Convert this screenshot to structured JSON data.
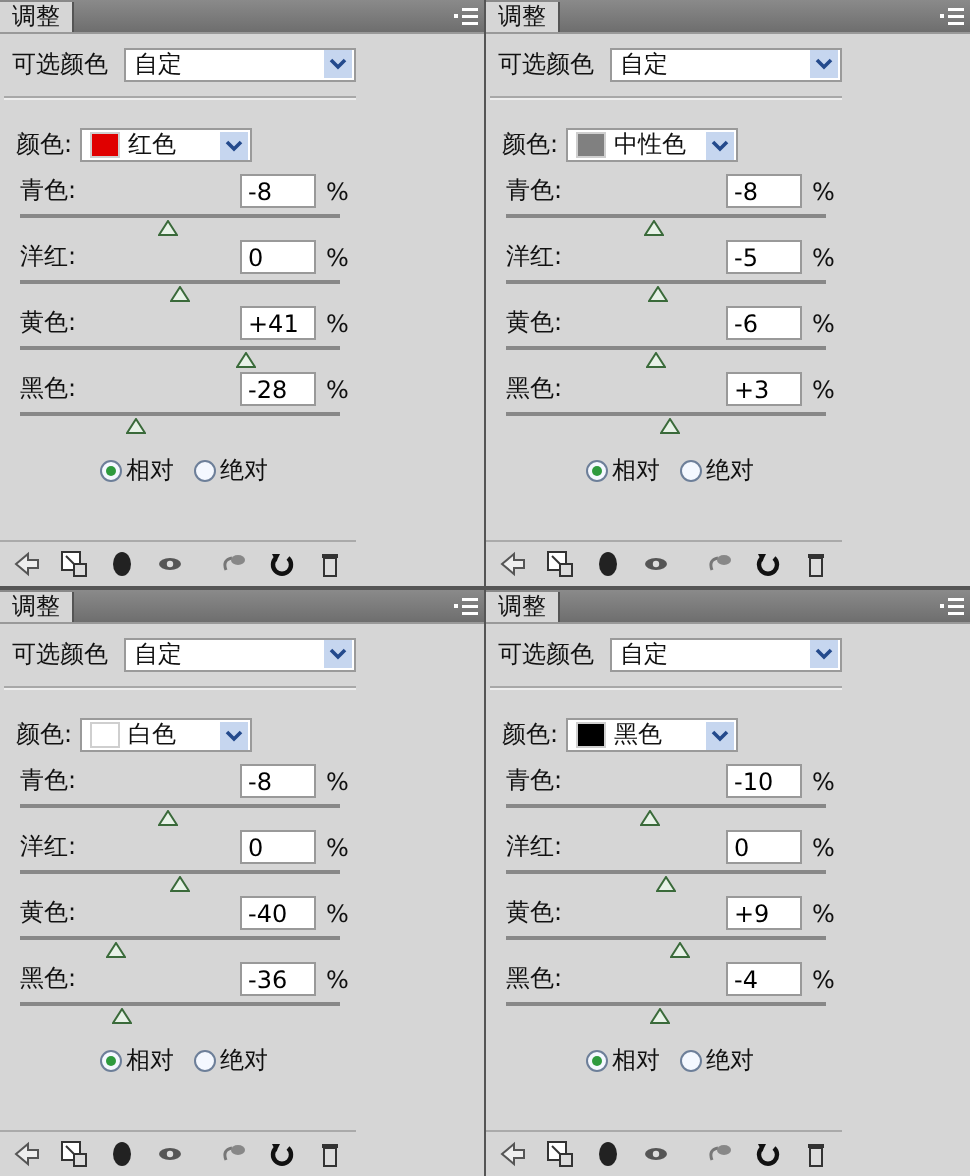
{
  "panels": [
    {
      "tab": "调整",
      "adjustment": "可选颜色",
      "preset": "自定",
      "color_label": "颜色:",
      "color_choice": {
        "name": "红色",
        "color": "#e00000"
      },
      "sliders": [
        {
          "label": "青色:",
          "value": "-8",
          "unit": "%",
          "level": 0.46
        },
        {
          "label": "洋红:",
          "value": "0",
          "unit": "%",
          "level": 0.5
        },
        {
          "label": "黄色:",
          "value": "+41",
          "unit": "%",
          "level": 0.705
        },
        {
          "label": "黑色:",
          "value": "-28",
          "unit": "%",
          "level": 0.36
        }
      ],
      "methods": [
        {
          "label": "相对",
          "selected": true
        },
        {
          "label": "绝对",
          "selected": false
        }
      ]
    },
    {
      "tab": "调整",
      "adjustment": "可选颜色",
      "preset": "自定",
      "color_label": "颜色:",
      "color_choice": {
        "name": "中性色",
        "color": "#808080"
      },
      "sliders": [
        {
          "label": "青色:",
          "value": "-8",
          "unit": "%",
          "level": 0.46
        },
        {
          "label": "洋红:",
          "value": "-5",
          "unit": "%",
          "level": 0.475
        },
        {
          "label": "黄色:",
          "value": "-6",
          "unit": "%",
          "level": 0.47
        },
        {
          "label": "黑色:",
          "value": "+3",
          "unit": "%",
          "level": 0.515
        }
      ],
      "methods": [
        {
          "label": "相对",
          "selected": true
        },
        {
          "label": "绝对",
          "selected": false
        }
      ]
    },
    {
      "tab": "调整",
      "adjustment": "可选颜色",
      "preset": "自定",
      "color_label": "颜色:",
      "color_choice": {
        "name": "白色",
        "color": "#ffffff"
      },
      "sliders": [
        {
          "label": "青色:",
          "value": "-8",
          "unit": "%",
          "level": 0.46
        },
        {
          "label": "洋红:",
          "value": "0",
          "unit": "%",
          "level": 0.5
        },
        {
          "label": "黄色:",
          "value": "-40",
          "unit": "%",
          "level": 0.3
        },
        {
          "label": "黑色:",
          "value": "-36",
          "unit": "%",
          "level": 0.32
        }
      ],
      "methods": [
        {
          "label": "相对",
          "selected": true
        },
        {
          "label": "绝对",
          "selected": false
        }
      ]
    },
    {
      "tab": "调整",
      "adjustment": "可选颜色",
      "preset": "自定",
      "color_label": "颜色:",
      "color_choice": {
        "name": "黑色",
        "color": "#000000"
      },
      "sliders": [
        {
          "label": "青色:",
          "value": "-10",
          "unit": "%",
          "level": 0.45
        },
        {
          "label": "洋红:",
          "value": "0",
          "unit": "%",
          "level": 0.5
        },
        {
          "label": "黄色:",
          "value": "+9",
          "unit": "%",
          "level": 0.545
        },
        {
          "label": "黑色:",
          "value": "-4",
          "unit": "%",
          "level": 0.48
        }
      ],
      "methods": [
        {
          "label": "相对",
          "selected": true
        },
        {
          "label": "绝对",
          "selected": false
        }
      ]
    }
  ]
}
